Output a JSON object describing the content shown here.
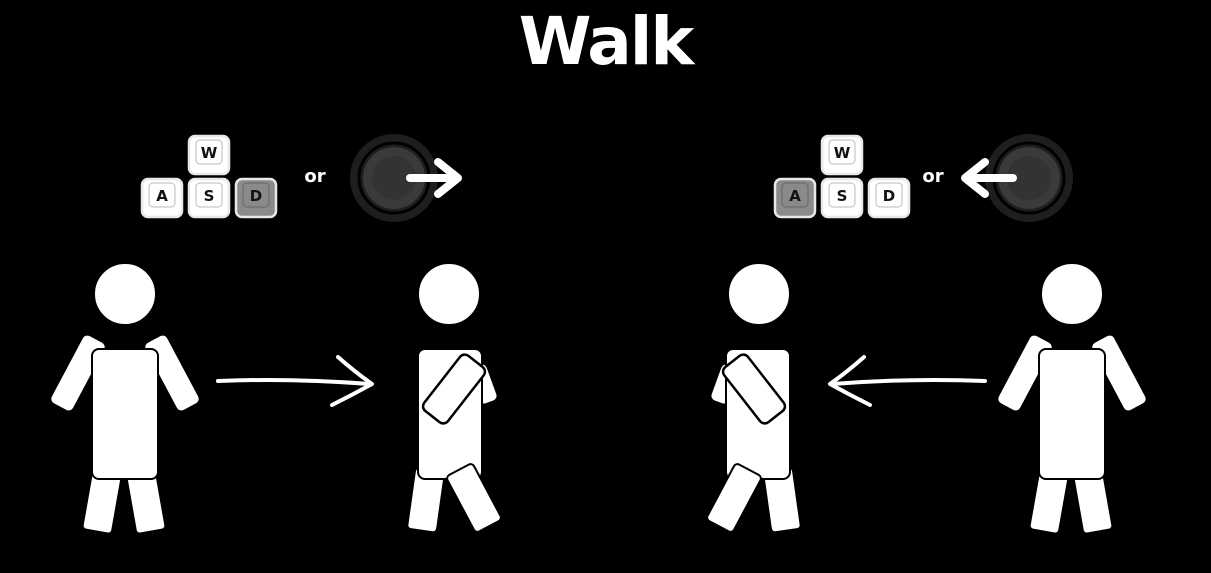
{
  "title": "Walk",
  "colors": {
    "background": "#000000",
    "foreground": "#ffffff",
    "key_face": "#ffffff",
    "key_pressed": "#8a8a8a",
    "stick_outer": "#1e1e1e",
    "stick_inner": "#3a3a3a"
  },
  "right_walk": {
    "keys": {
      "up": "W",
      "left": "A",
      "down": "S",
      "right": "D"
    },
    "pressed_key": "D",
    "or_label": "or",
    "stick_direction": "right",
    "icons": [
      "keyboard-wasd-icon",
      "joystick-right-icon",
      "arrow-right-icon"
    ]
  },
  "left_walk": {
    "keys": {
      "up": "W",
      "left": "A",
      "down": "S",
      "right": "D"
    },
    "pressed_key": "A",
    "or_label": "or",
    "stick_direction": "left",
    "icons": [
      "keyboard-wasd-icon",
      "joystick-left-icon",
      "arrow-left-icon"
    ]
  }
}
